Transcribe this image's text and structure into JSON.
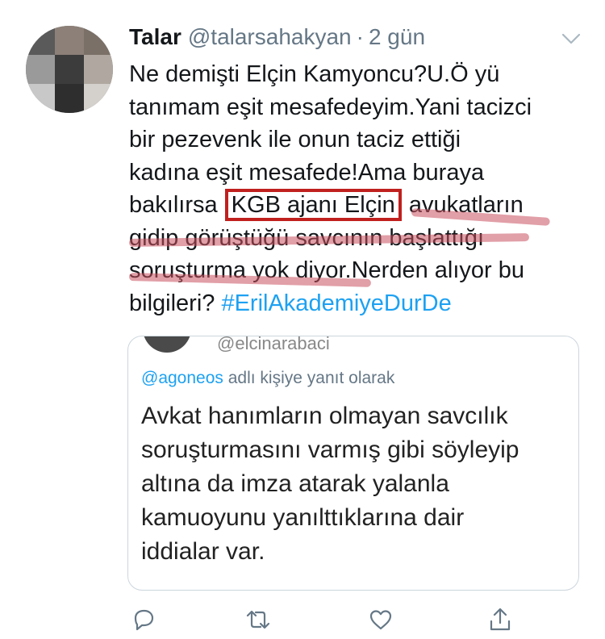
{
  "tweet": {
    "author_name": "Talar",
    "author_handle": "@talarsahakyan",
    "separator": "·",
    "time": "2 gün",
    "lines": [
      "Ne demişti Elçin Kamyoncu?U.Ö yü",
      "tanımam eşit mesafedeyim.Yani tacizci",
      "bir pezevenk ile onun taciz ettiği",
      "kadına eşit mesafede!Ama buraya"
    ],
    "line5_before": "bakılırsa ",
    "line5_boxed": "KGB ajanı Elçin",
    "line5_after": " avukatların",
    "line6": "gidip görüştüğü savcının başlattığı",
    "line7": "soruşturma yok diyor.Nerden alıyor bu",
    "line8_text": "bilgileri? ",
    "hashtag": "#ErilAkademiyeDurDe"
  },
  "quote": {
    "handle": "@elcinarabaci",
    "reply_mention": "@agoneos",
    "reply_suffix": " adlı kişiye yanıt olarak",
    "lines": [
      "Avkat hanımların olmayan savcılık",
      "soruşturmasını varmış gibi söyleyip",
      "altına da imza atarak yalanla",
      "kamuoyunu yanılttıklarına dair",
      "iddialar var."
    ]
  },
  "colors": {
    "text": "#14171a",
    "secondary": "#657786",
    "link": "#1da1f2",
    "annotation_box": "#c0201e",
    "annotation_strike": "#c8505f"
  },
  "icons": {
    "menu": "chevron-down-icon",
    "reply": "reply-icon",
    "retweet": "retweet-icon",
    "like": "heart-icon",
    "share": "share-icon"
  }
}
